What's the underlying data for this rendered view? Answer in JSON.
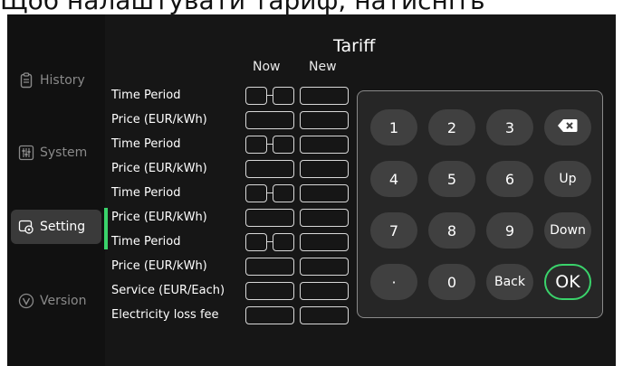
{
  "caption": "Щоб налаштувати тариф, натисніть",
  "sidebar": {
    "items": [
      {
        "label": "History",
        "icon": "clipboard-icon"
      },
      {
        "label": "System",
        "icon": "sliders-icon"
      },
      {
        "label": "Setting",
        "icon": "settings-icon",
        "active": true
      },
      {
        "label": "Version",
        "icon": "version-icon"
      }
    ]
  },
  "main": {
    "title": "Tariff",
    "columns": {
      "now": "Now",
      "new": "New"
    },
    "rows": [
      {
        "label": "Time Period",
        "kind": "time"
      },
      {
        "label": "Price (EUR/kWh)",
        "kind": "value"
      },
      {
        "label": "Time Period",
        "kind": "time"
      },
      {
        "label": "Price (EUR/kWh)",
        "kind": "value"
      },
      {
        "label": "Time Period",
        "kind": "time"
      },
      {
        "label": "Price (EUR/kWh)",
        "kind": "value"
      },
      {
        "label": "Time Period",
        "kind": "time"
      },
      {
        "label": "Price (EUR/kWh)",
        "kind": "value"
      },
      {
        "label": "Service (EUR/Each)",
        "kind": "value"
      },
      {
        "label": "Electricity loss fee",
        "kind": "value"
      }
    ]
  },
  "keypad": {
    "keys": [
      {
        "label": "1"
      },
      {
        "label": "2"
      },
      {
        "label": "3"
      },
      {
        "label": "",
        "icon": "backspace-icon"
      },
      {
        "label": "4"
      },
      {
        "label": "5"
      },
      {
        "label": "6"
      },
      {
        "label": "Up"
      },
      {
        "label": "7"
      },
      {
        "label": "8"
      },
      {
        "label": "9"
      },
      {
        "label": "Down"
      },
      {
        "label": "·"
      },
      {
        "label": "0"
      },
      {
        "label": "Back"
      },
      {
        "label": "OK"
      }
    ]
  },
  "colors": {
    "accent": "#3ad36b",
    "background": "#161616",
    "sidebar": "#111111",
    "key": "#404040"
  }
}
